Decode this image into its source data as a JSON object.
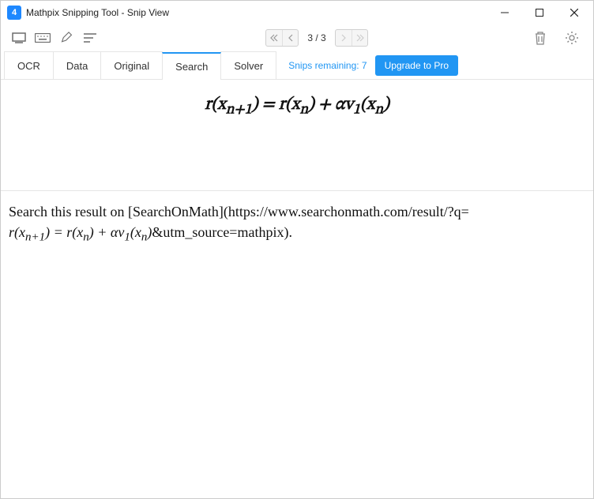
{
  "window": {
    "title": "Mathpix Snipping Tool - Snip View",
    "logo_text": "4"
  },
  "pager": {
    "text": "3 / 3"
  },
  "tabs": {
    "ocr": "OCR",
    "data": "Data",
    "original": "Original",
    "search": "Search",
    "solver": "Solver"
  },
  "snips": {
    "remaining_label": "Snips remaining: 7",
    "upgrade": "Upgrade to Pro"
  },
  "equation_html": "r(x<sub>n+1</sub>) = r(x<sub>n</sub>) + αv<sub>1</sub>(x<sub>n</sub>)",
  "search_result": {
    "prefix": "Search this result on [SearchOnMath](https://www.searchonmath.com/result/?q=",
    "eq_html": "r(x<sub>n+1</sub>) = r(x<sub>n</sub>) + αv<sub>1</sub>(x<sub>n</sub>)",
    "suffix": "&utm_source=mathpix)."
  }
}
